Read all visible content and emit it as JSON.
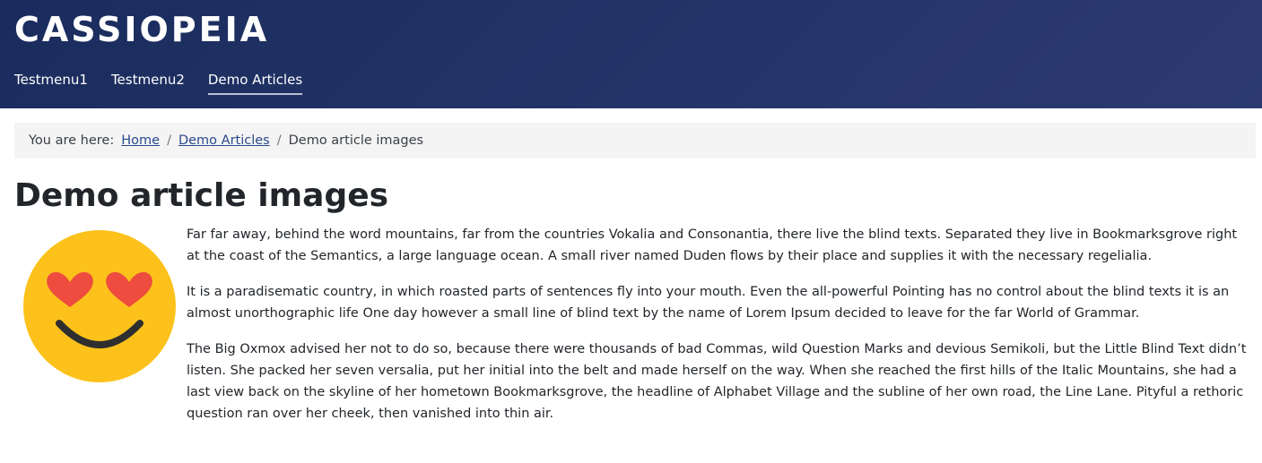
{
  "site": {
    "brand": "CASSIOPEIA",
    "header_color": "#1a2c5d"
  },
  "menu": {
    "items": [
      {
        "label": "Testmenu1",
        "active": false
      },
      {
        "label": "Testmenu2",
        "active": false
      },
      {
        "label": "Demo Articles",
        "active": true
      }
    ]
  },
  "breadcrumb": {
    "prefix": "You are here:",
    "items": [
      {
        "label": "Home",
        "link": true
      },
      {
        "label": "Demo Articles",
        "link": true
      },
      {
        "label": "Demo article images",
        "link": false
      }
    ],
    "separator": "/"
  },
  "article": {
    "title": "Demo article images",
    "image_icon": "heart-eyes-emoji",
    "paragraphs": [
      "Far far away, behind the word mountains, far from the countries Vokalia and Consonantia, there live the blind texts. Separated they live in Bookmarksgrove right at the coast of the Semantics, a large language ocean. A small river named Duden flows by their place and supplies it with the necessary regelialia.",
      "It is a paradisematic country, in which roasted parts of sentences fly into your mouth. Even the all-powerful Pointing has no control about the blind texts it is an almost unorthographic life One day however a small line of blind text by the name of Lorem Ipsum decided to leave for the far World of Grammar.",
      "The Big Oxmox advised her not to do so, because there were thousands of bad Commas, wild Question Marks and devious Semikoli, but the Little Blind Text didn’t listen. She packed her seven versalia, put her initial into the belt and made herself on the way. When she reached the first hills of the Italic Mountains, she had a last view back on the skyline of her hometown Bookmarksgrove, the headline of Alphabet Village and the subline of her own road, the Line Lane. Pityful a rethoric question ran over her cheek, then vanished into thin air."
    ]
  }
}
